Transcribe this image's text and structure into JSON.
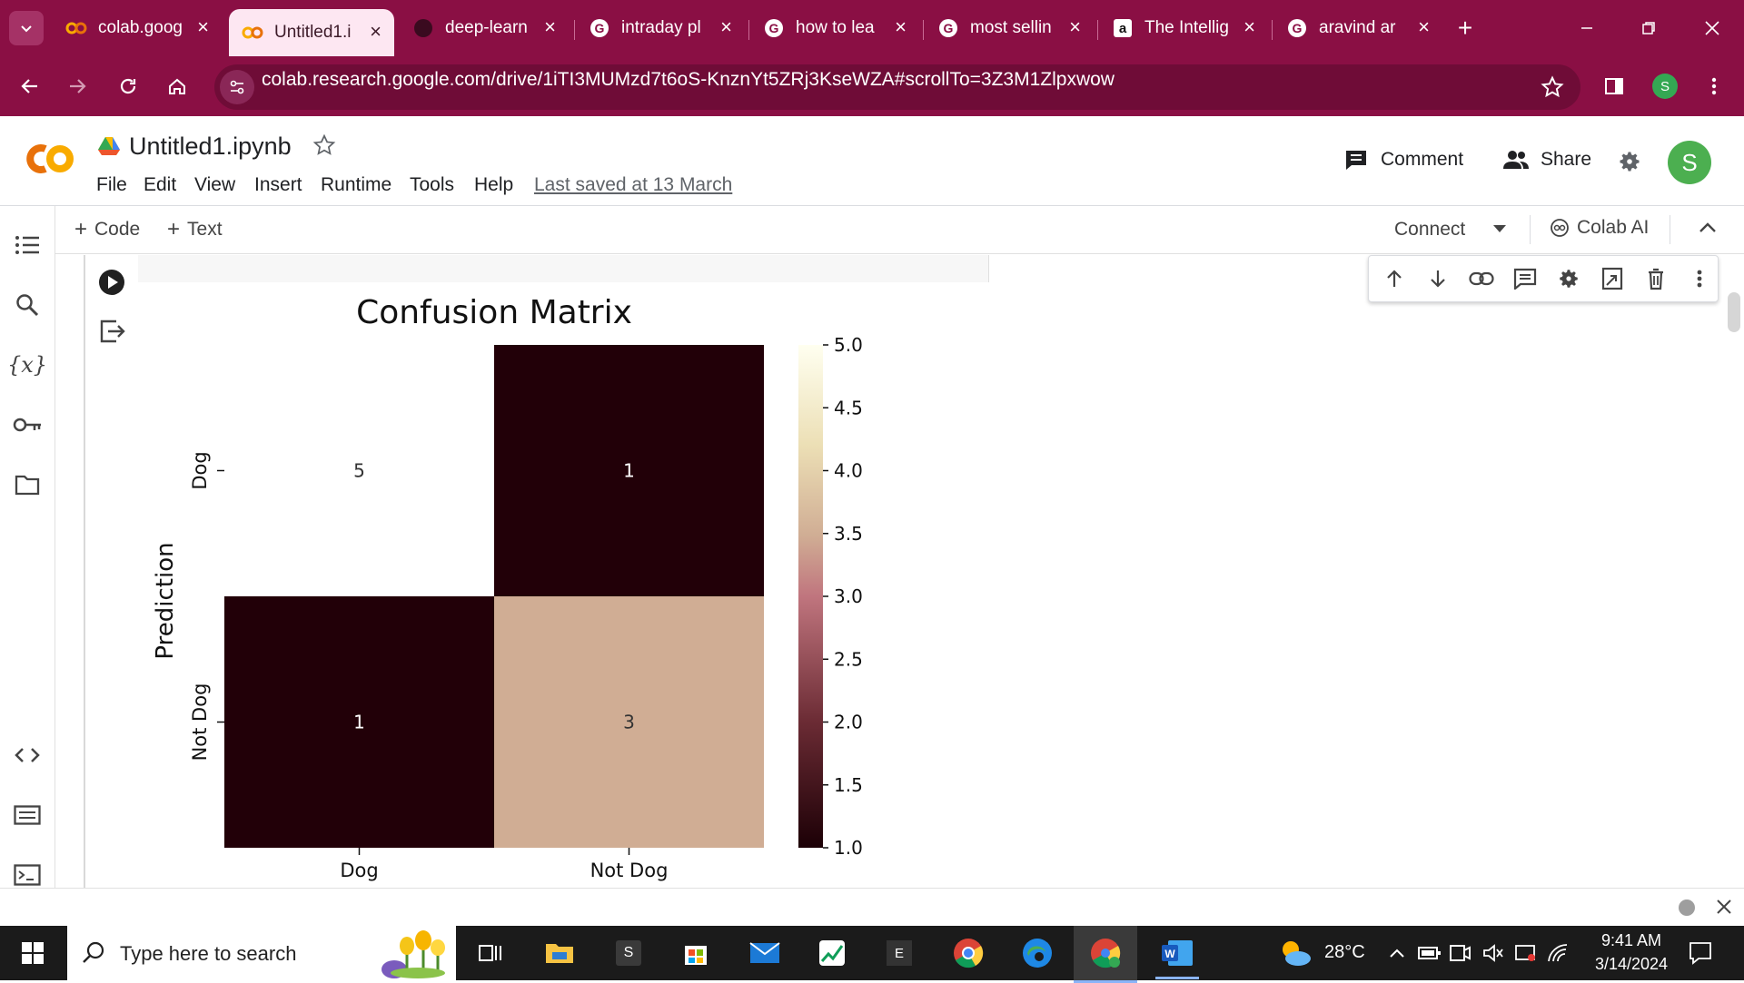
{
  "browser": {
    "tabs": [
      {
        "label": "colab.goog",
        "icon": "colab-icon",
        "active": false
      },
      {
        "label": "Untitled1.i",
        "icon": "colab-icon",
        "active": true
      },
      {
        "label": "deep-learn",
        "icon": "github-icon",
        "active": false
      },
      {
        "label": "intraday pl",
        "icon": "google-icon",
        "active": false
      },
      {
        "label": "how to lea",
        "icon": "google-icon",
        "active": false
      },
      {
        "label": "most sellin",
        "icon": "google-icon",
        "active": false
      },
      {
        "label": "The Intellig",
        "icon": "amazon-icon",
        "active": false
      },
      {
        "label": "aravind ar",
        "icon": "google-icon",
        "active": false
      }
    ],
    "url": "colab.research.google.com/drive/1iTI3MUMzd7t6oS-KnznYt5ZRj3KseWZA#scrollTo=3Z3M1Zlpxwow",
    "profile_initial": "S",
    "accent_color": "#8a0f44"
  },
  "colab": {
    "logo": "CO",
    "notebook_title": "Untitled1.ipynb",
    "menu": [
      "File",
      "Edit",
      "View",
      "Insert",
      "Runtime",
      "Tools",
      "Help"
    ],
    "last_saved": "Last saved at 13 March",
    "comment_label": "Comment",
    "share_label": "Share",
    "user_initial": "S",
    "add_code_label": "Code",
    "add_text_label": "Text",
    "connect_label": "Connect",
    "colab_ai_label": "Colab AI"
  },
  "chart_data": {
    "type": "heatmap",
    "title": "Confusion Matrix",
    "ylabel": "Prediction",
    "xlabel": "",
    "x_categories": [
      "Dog",
      "Not Dog"
    ],
    "y_categories": [
      "Dog",
      "Not Dog"
    ],
    "values": [
      [
        5,
        1
      ],
      [
        1,
        3
      ]
    ],
    "colorbar": {
      "min": 1.0,
      "max": 5.0,
      "ticks": [
        "5.0",
        "4.5",
        "4.0",
        "3.5",
        "3.0",
        "2.5",
        "2.0",
        "1.5",
        "1.0"
      ]
    },
    "colors": {
      "low": "#220008",
      "mid": "#b47178",
      "high": "#fffff0",
      "value_3": "#d0ad94"
    }
  },
  "taskbar": {
    "search_placeholder": "Type here to search",
    "weather": "28°C",
    "time": "9:41 AM",
    "date": "3/14/2024"
  }
}
